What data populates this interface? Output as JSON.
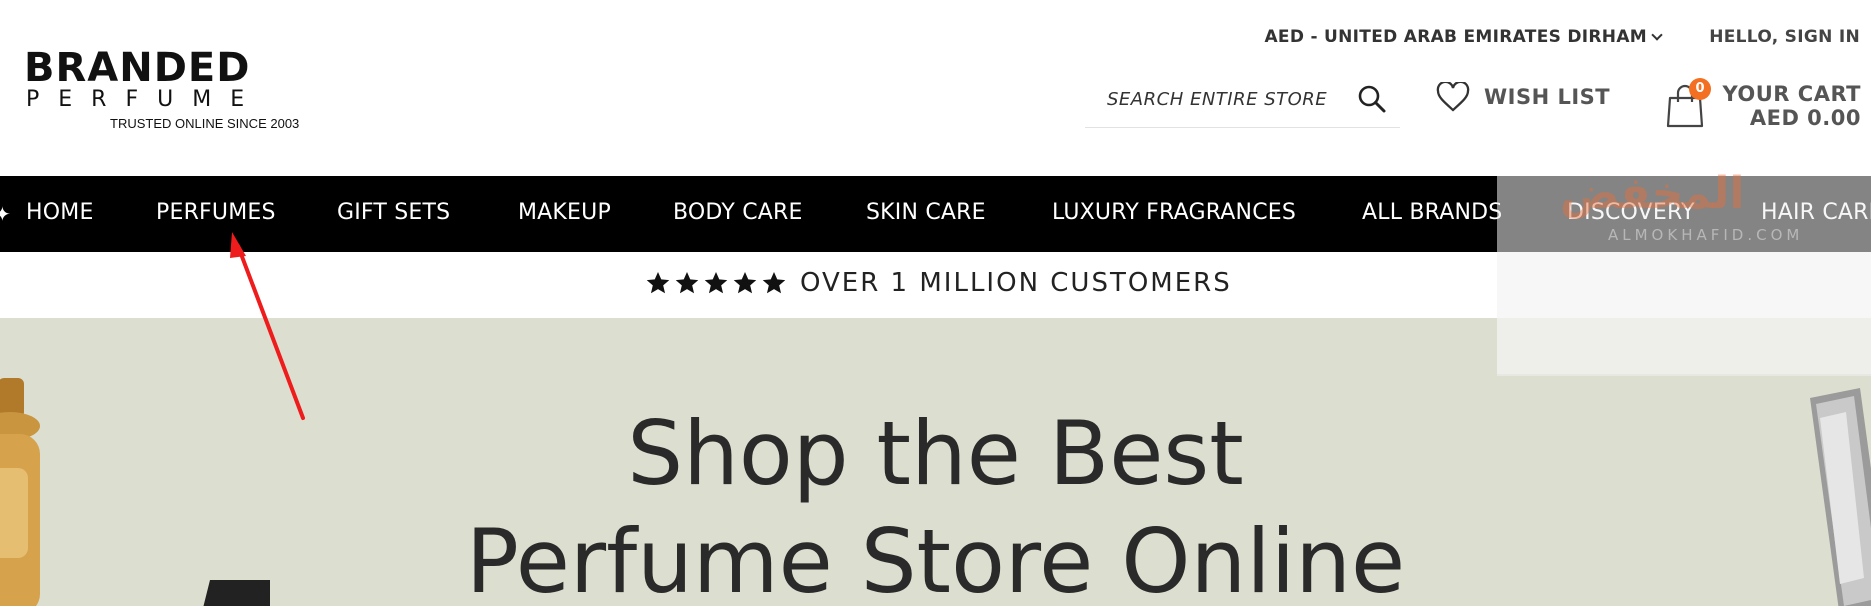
{
  "logo": {
    "line1": "BRANDED",
    "line2": "PERFUME",
    "tagline": "TRUSTED ONLINE SINCE 2003"
  },
  "header": {
    "currency_label": "AED - UNITED ARAB EMIRATES DIRHAM",
    "signin_label": "HELLO, SIGN IN",
    "search_placeholder": "SEARCH ENTIRE STORE",
    "wishlist_label": "WISH LIST",
    "cart": {
      "count": "0",
      "title": "YOUR CART",
      "total": "AED 0.00"
    }
  },
  "nav": {
    "items": [
      "HOME",
      "PERFUMES",
      "GIFT SETS",
      "MAKEUP",
      "BODY CARE",
      "SKIN CARE",
      "LUXURY FRAGRANCES",
      "ALL BRANDS",
      "DISCOVERY",
      "HAIR CARE"
    ]
  },
  "strip": {
    "stars": 5,
    "text": "OVER 1 MILLION CUSTOMERS"
  },
  "hero": {
    "line1": "Shop the Best",
    "line2": "Perfume Store Online"
  },
  "watermark": {
    "arabic": "المخفض",
    "latin": "ALMOKHAFID.COM"
  },
  "colors": {
    "nav_bg": "#000000",
    "hero_bg": "#dcdecf",
    "badge": "#f36f21",
    "annotation": "#ee1c1c"
  }
}
